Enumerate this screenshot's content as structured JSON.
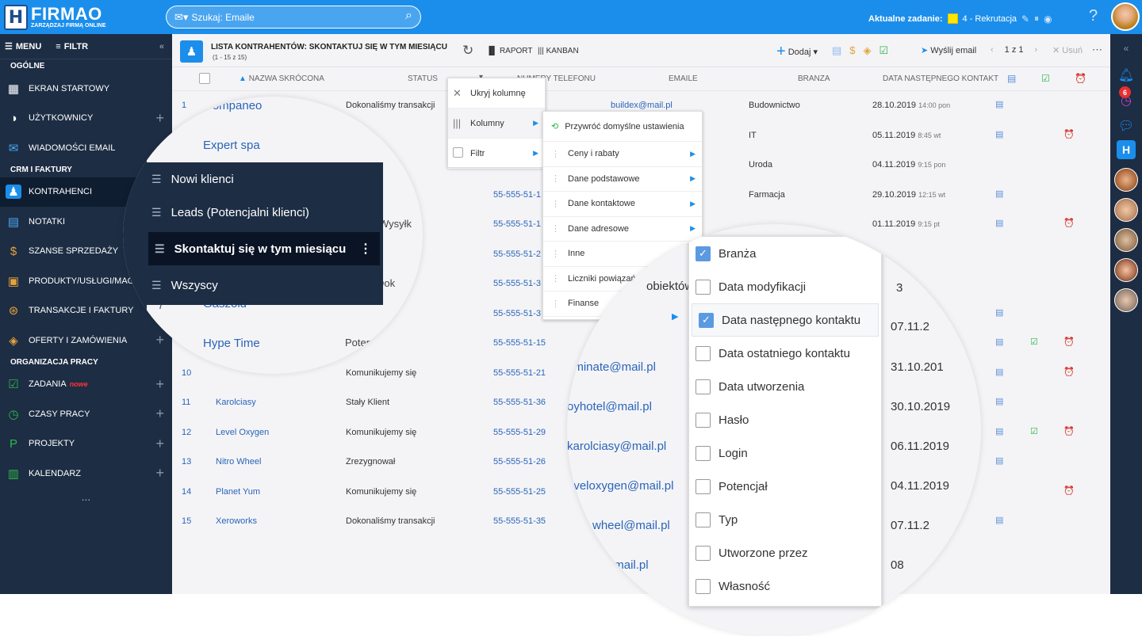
{
  "app": {
    "logo_mark": "H",
    "logo_name": "FIRMAO",
    "logo_sub": "ZARZĄDZAJ FIRMĄ ONLINE"
  },
  "search": {
    "placeholder": "Szukaj: Emaile"
  },
  "task": {
    "label": "Aktualne zadanie:",
    "value": "4 - Rekrutacja",
    "color": "#ffe600"
  },
  "sidebar": {
    "menu_label": "MENU",
    "filter_label": "FILTR",
    "sections": [
      {
        "title": "OGÓLNE",
        "items": [
          {
            "label": "EKRAN STARTOWY",
            "icon": "grid-icon"
          },
          {
            "label": "UŻYTKOWNICY",
            "icon": "users-icon"
          },
          {
            "label": "WIADOMOŚCI EMAIL",
            "icon": "mail-icon"
          }
        ]
      },
      {
        "title": "CRM I FAKTURY",
        "items": [
          {
            "label": "KONTRAHENCI",
            "icon": "contacts-icon"
          },
          {
            "label": "NOTATKI",
            "icon": "notes-icon"
          },
          {
            "label": "SZANSE SPRZEDAŻY",
            "icon": "moneybag-icon"
          },
          {
            "label": "PRODUKTY/USŁUGI/MAGA",
            "icon": "box-icon"
          },
          {
            "label": "TRANSAKCJE I FAKTURY",
            "icon": "dollar-icon"
          },
          {
            "label": "OFERTY I ZAMÓWIENIA",
            "icon": "tag-icon"
          }
        ]
      },
      {
        "title": "ORGANIZACJA PRACY",
        "items": [
          {
            "label": "ZADANIA",
            "badge": "nowe",
            "icon": "checkbox-icon"
          },
          {
            "label": "CZASY PRACY",
            "icon": "clock-icon"
          },
          {
            "label": "PROJEKTY",
            "icon": "project-icon"
          },
          {
            "label": "KALENDARZ",
            "icon": "calendar-icon"
          }
        ]
      }
    ],
    "more": "..."
  },
  "toolbar": {
    "title": "LISTA KONTRAHENTÓW: SKONTAKTUJ SIĘ W TYM MIESIĄCU",
    "subtitle": "(1 - 15 z 15)",
    "raport": "RAPORT",
    "kanban": "KANBAN",
    "add": "Dodaj",
    "send": "Wyślij email",
    "page": "1",
    "of": "z 1",
    "delete": "Usuń"
  },
  "columns": [
    "NAZWA SKRÓCONA",
    "STATUS",
    "NUMERY TELEFONU",
    "EMAILE",
    "BRANZA",
    "DATA NASTĘPNEGO KONTAKT"
  ],
  "rows": [
    {
      "n": "1",
      "name": "",
      "status": "Dokonaliśmy transakcji",
      "phone": "",
      "email": "buildex@mail.pl",
      "branch": "Budownictwo",
      "date": "28.10.2019",
      "time": "14:00 pon",
      "note": true,
      "chk": false,
      "alarm": false
    },
    {
      "n": "",
      "name": "",
      "status": "",
      "phone": "",
      "email": "",
      "branch": "IT",
      "date": "05.11.2019",
      "time": "8:45 wt",
      "note": true,
      "chk": false,
      "alarm": true
    },
    {
      "n": "",
      "name": "",
      "status": "",
      "phone": "",
      "email": "",
      "branch": "Uroda",
      "date": "04.11.2019",
      "time": "9:15 pon",
      "note": false,
      "chk": false,
      "alarm": false
    },
    {
      "n": "",
      "name": "",
      "status": "transakcji",
      "phone": "55-555-51-1",
      "email": "",
      "branch": "Farmacja",
      "date": "29.10.2019",
      "time": "12:15 wt",
      "note": true,
      "chk": false,
      "alarm": false
    },
    {
      "n": "",
      "name": "",
      "status": "",
      "phone": "55-555-51-1",
      "email": "",
      "branch": "",
      "date": "01.11.2019",
      "time": "9:15 pt",
      "note": true,
      "chk": false,
      "alarm": true
    },
    {
      "n": "",
      "name": "",
      "status": "transakcji",
      "phone": "55-555-51-2",
      "email": "",
      "branch": "",
      "date": "",
      "time": "",
      "note": false,
      "chk": false,
      "alarm": false
    },
    {
      "n": "",
      "name": "",
      "status": "transakcji",
      "phone": "55-555-51-3",
      "email": "",
      "branch": "",
      "date": "",
      "time": "",
      "note": false,
      "chk": false,
      "alarm": false
    },
    {
      "n": "",
      "name": "",
      "status": "",
      "phone": "55-555-51-3",
      "email": "",
      "branch": "",
      "date": "",
      "time": "",
      "note": true,
      "chk": false,
      "alarm": false
    },
    {
      "n": "",
      "name": "",
      "status": "",
      "phone": "55-555-51-15",
      "email": "",
      "branch": "",
      "date": "",
      "time": "",
      "note": true,
      "chk": true,
      "alarm": true
    },
    {
      "n": "10",
      "name": "",
      "status": "Komunikujemy się",
      "phone": "55-555-51-21",
      "email": "",
      "branch": "",
      "date": "",
      "time": "",
      "note": true,
      "chk": false,
      "alarm": true
    },
    {
      "n": "11",
      "name": "Karolciasy",
      "status": "Stały Klient",
      "phone": "55-555-51-36",
      "email": "",
      "branch": "",
      "date": "",
      "time": "",
      "note": true,
      "chk": false,
      "alarm": false
    },
    {
      "n": "12",
      "name": "Level Oxygen",
      "status": "Komunikujemy się",
      "phone": "55-555-51-29",
      "email": "",
      "branch": "",
      "date": "",
      "time": "",
      "note": true,
      "chk": true,
      "alarm": true
    },
    {
      "n": "13",
      "name": "Nitro Wheel",
      "status": "Zrezygnował",
      "phone": "55-555-51-26",
      "email": "",
      "branch": "",
      "date": "",
      "time": "",
      "note": true,
      "chk": false,
      "alarm": false
    },
    {
      "n": "14",
      "name": "Planet Yum",
      "status": "Komunikujemy się",
      "phone": "55-555-51-25",
      "email": "",
      "branch": "",
      "date": "",
      "time": "",
      "note": false,
      "chk": false,
      "alarm": true
    },
    {
      "n": "15",
      "name": "Xeroworks",
      "status": "Dokonaliśmy transakcji",
      "phone": "55-555-51-35",
      "email": "",
      "branch": "",
      "date": "",
      "time": "",
      "note": true,
      "chk": false,
      "alarm": false
    }
  ],
  "context_menu": {
    "hide": "Ukryj kolumnę",
    "columns": "Kolumny",
    "filter": "Filtr"
  },
  "submenu": {
    "restore": "Przywróć domyślne ustawienia",
    "groups": [
      "Ceny i rabaty",
      "Dane podstawowe",
      "Dane kontaktowe",
      "Dane adresowe",
      "Inne",
      "Liczniki powiązań",
      "Finanse"
    ]
  },
  "mag1": {
    "names": [
      "Companeo",
      "Expert spa",
      "Gaszold",
      "Hype Time"
    ],
    "status_frag": [
      "otencjalny",
      "ent",
      "Dok",
      "Wysyłk",
      "Dok",
      "Potencjalny"
    ],
    "phone_frag": [
      "5"
    ],
    "filters": [
      {
        "label": "Nowi klienci"
      },
      {
        "label": "Leads (Potencjalni klienci)"
      },
      {
        "label": "Skontaktuj się w tym miesiącu",
        "active": true
      },
      {
        "label": "Wszyscy"
      }
    ],
    "num3": "3",
    "num7": "7"
  },
  "mag2": {
    "visible_fragments": [
      "obiektów",
      "uminate@mail.pl",
      "oyhotel@mail.pl",
      "karolciasy@mail.pl",
      "eveloxygen@mail.pl",
      "wheel@mail.pl",
      "@mail.pl"
    ],
    "date_fragments": [
      "3",
      "07.11.2",
      "31.10.201",
      "30.10.2019",
      "06.11.2019",
      "04.11.2019",
      "07.11.2",
      "08"
    ],
    "checkbox_columns": [
      {
        "label": "Branża",
        "checked": true
      },
      {
        "label": "Data modyfikacji",
        "checked": false
      },
      {
        "label": "Data następnego kontaktu",
        "checked": true
      },
      {
        "label": "Data ostatniego kontaktu",
        "checked": false
      },
      {
        "label": "Data utworzenia",
        "checked": false
      },
      {
        "label": "Hasło",
        "checked": false
      },
      {
        "label": "Login",
        "checked": false
      },
      {
        "label": "Potencjał",
        "checked": false
      },
      {
        "label": "Typ",
        "checked": false
      },
      {
        "label": "Utworzone przez",
        "checked": false
      },
      {
        "label": "Własność",
        "checked": false
      }
    ]
  },
  "rightbar": {
    "badge": "6"
  },
  "colors": {
    "topbar": "#1b8eeb",
    "sidebar": "#1d2d44",
    "accent": "#2a64b8"
  }
}
